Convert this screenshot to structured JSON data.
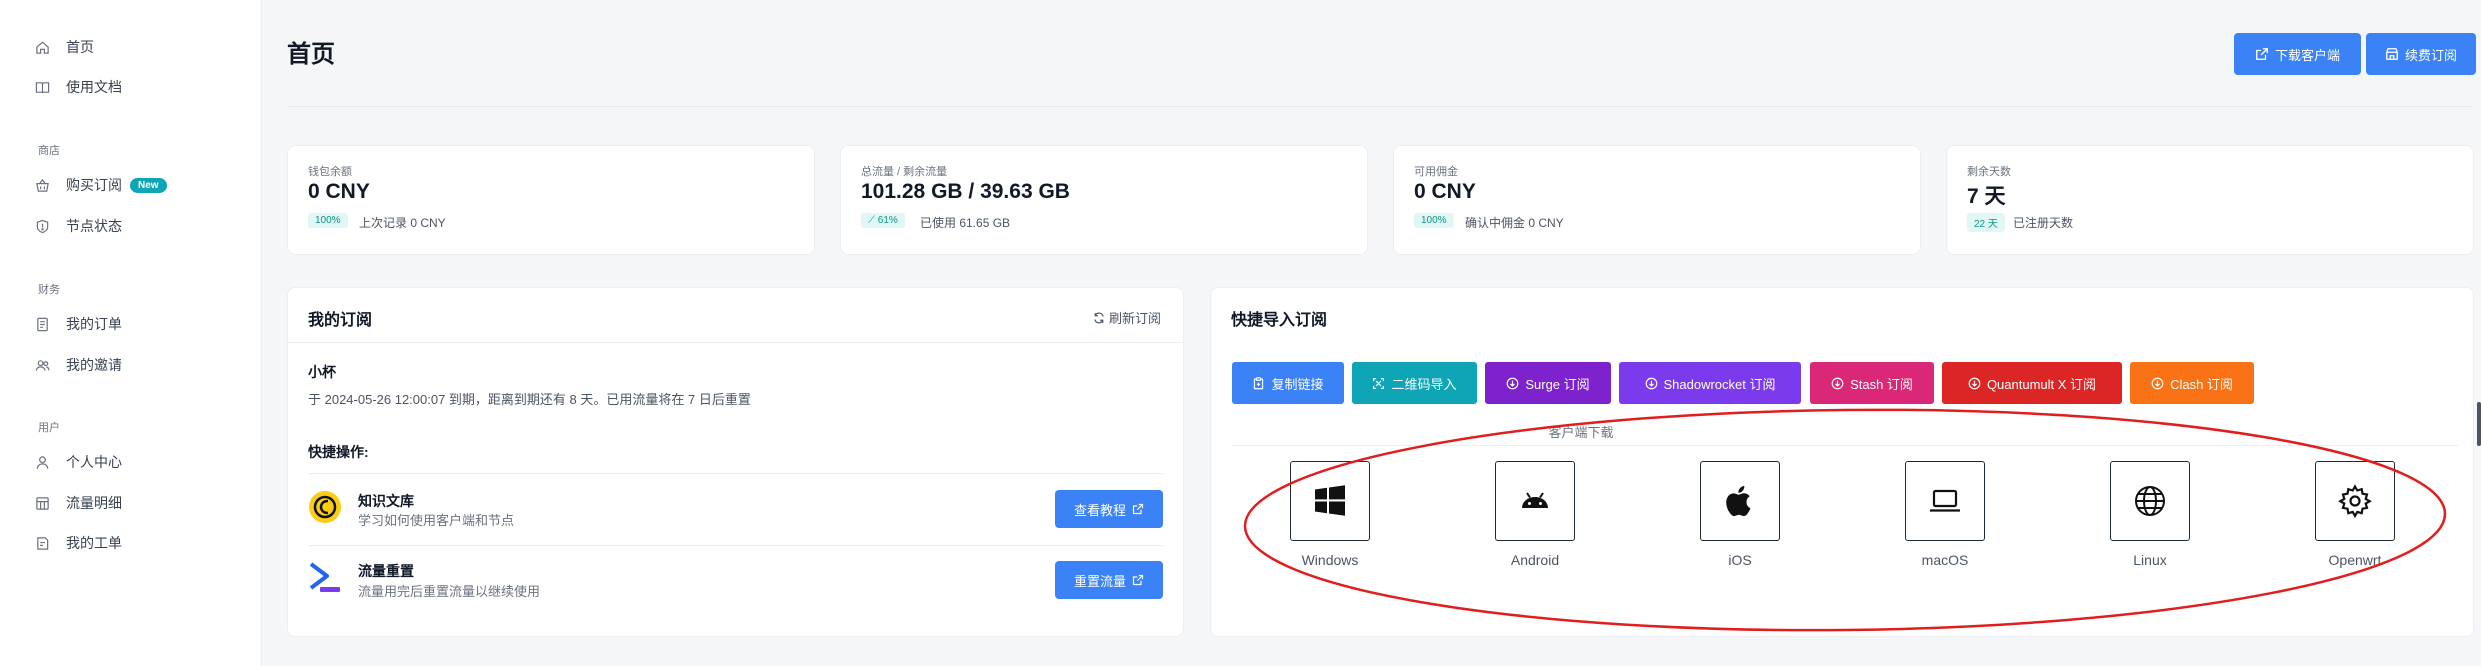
{
  "sidebar": {
    "home": "首页",
    "docs": "使用文档",
    "section_shop": "商店",
    "buy": "购买订阅",
    "new_badge": "New",
    "nodes": "节点状态",
    "section_finance": "财务",
    "orders": "我的订单",
    "invite": "我的邀请",
    "section_user": "用户",
    "profile": "个人中心",
    "traffic": "流量明细",
    "tickets": "我的工单"
  },
  "header": {
    "title": "首页",
    "download_btn": "下载客户端",
    "renew_btn": "续费订阅"
  },
  "stats": [
    {
      "label": "钱包余额",
      "value": "0 CNY",
      "badge": "100%",
      "note": "上次记录 0 CNY"
    },
    {
      "label": "总流量 / 剩余流量",
      "value": "101.28 GB / 39.63 GB",
      "badge": "61%",
      "note": "已使用 61.65 GB"
    },
    {
      "label": "可用佣金",
      "value": "0 CNY",
      "badge": "100%",
      "note": "确认中佣金 0 CNY"
    },
    {
      "label": "剩余天数",
      "value": "7 天",
      "badge": "22 天",
      "note": "已注册天数"
    }
  ],
  "subscription": {
    "title": "我的订阅",
    "refresh": "刷新订阅",
    "plan_name": "小杯",
    "info": "于 2024-05-26 12:00:07 到期，距离到期还有 8 天。已用流量将在 7 日后重置",
    "quick_label": "快捷操作:",
    "items": [
      {
        "title": "知识文库",
        "desc": "学习如何使用客户端和节点",
        "button": "查看教程"
      },
      {
        "title": "流量重置",
        "desc": "流量用完后重置流量以继续使用",
        "button": "重置流量"
      }
    ]
  },
  "quick_import": {
    "title": "快捷导入订阅",
    "buttons": [
      {
        "label": "复制链接",
        "color": "#3b82f6",
        "icon": "clipboard-icon"
      },
      {
        "label": "二维码导入",
        "color": "#0ea5b7",
        "icon": "qrcode-icon"
      },
      {
        "label": "Surge 订阅",
        "color": "#7e22ce",
        "icon": "download-icon"
      },
      {
        "label": "Shadowrocket 订阅",
        "color": "#7c3aed",
        "icon": "download-icon"
      },
      {
        "label": "Stash 订阅",
        "color": "#db2777",
        "icon": "download-icon"
      },
      {
        "label": "Quantumult X 订阅",
        "color": "#dc2626",
        "icon": "download-icon"
      },
      {
        "label": "Clash 订阅",
        "color": "#f97316",
        "icon": "download-icon"
      }
    ],
    "download_title": "客户端下载",
    "clients": [
      {
        "name": "Windows",
        "icon": "windows-icon"
      },
      {
        "name": "Android",
        "icon": "android-icon"
      },
      {
        "name": "iOS",
        "icon": "apple-icon"
      },
      {
        "name": "macOS",
        "icon": "laptop-icon"
      },
      {
        "name": "Linux",
        "icon": "globe-icon"
      },
      {
        "name": "Openwrt",
        "icon": "gear-icon"
      }
    ]
  },
  "colors": {
    "primary": "#3b82f6",
    "annotation": "#e11d1d"
  }
}
